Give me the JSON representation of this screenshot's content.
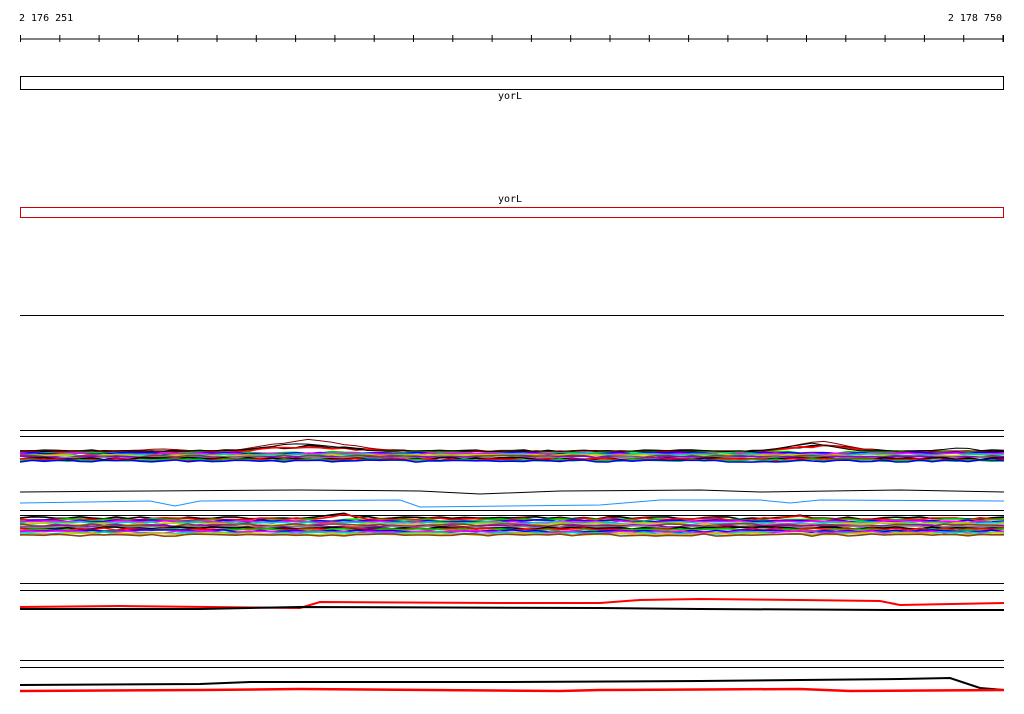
{
  "ruler": {
    "start_label": "2 176 251",
    "end_label": "2 178 750"
  },
  "genes": {
    "forward_label": "yorL",
    "reverse_label": "yorL",
    "forward_color": "#000000",
    "reverse_color": "#cc0000"
  },
  "track_colors": {
    "profile_black": "#000000",
    "profile_red": "#ff0000",
    "profile_darkred": "#8b0000",
    "profile_blue": "#1e90ff",
    "multi": [
      "#000000",
      "#ff0000",
      "#00cc00",
      "#0000ff",
      "#ff00ff",
      "#00cccc",
      "#cccc00",
      "#8b4513",
      "#9400d3",
      "#808080"
    ]
  }
}
